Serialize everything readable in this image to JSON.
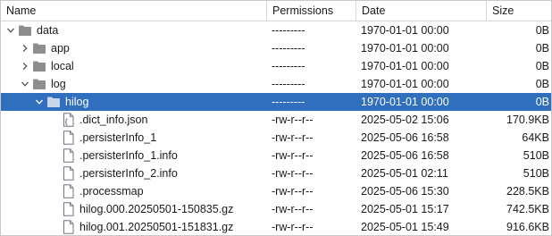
{
  "columns": {
    "name": "Name",
    "permissions": "Permissions",
    "date": "Date",
    "size": "Size"
  },
  "rows": [
    {
      "name": "data",
      "type": "folder",
      "expanded": true,
      "level": 0,
      "permissions": "---------",
      "date": "1970-01-01 00:00",
      "size": "0B"
    },
    {
      "name": "app",
      "type": "folder",
      "expanded": false,
      "level": 1,
      "permissions": "---------",
      "date": "1970-01-01 00:00",
      "size": "0B"
    },
    {
      "name": "local",
      "type": "folder",
      "expanded": false,
      "level": 1,
      "permissions": "---------",
      "date": "1970-01-01 00:00",
      "size": "0B"
    },
    {
      "name": "log",
      "type": "folder",
      "expanded": true,
      "level": 1,
      "permissions": "---------",
      "date": "1970-01-01 00:00",
      "size": "0B"
    },
    {
      "name": "hilog",
      "type": "folder",
      "expanded": true,
      "level": 2,
      "selected": true,
      "permissions": "---------",
      "date": "1970-01-01 00:00",
      "size": "0B"
    },
    {
      "name": ".dict_info.json",
      "type": "file-json",
      "level": 3,
      "permissions": "-rw-r--r--",
      "date": "2025-05-02 15:06",
      "size": "170.9KB"
    },
    {
      "name": ".persisterInfo_1",
      "type": "file",
      "level": 3,
      "permissions": "-rw-r--r--",
      "date": "2025-05-06 16:58",
      "size": "64KB"
    },
    {
      "name": ".persisterInfo_1.info",
      "type": "file",
      "level": 3,
      "permissions": "-rw-r--r--",
      "date": "2025-05-06 16:58",
      "size": "510B"
    },
    {
      "name": ".persisterInfo_2.info",
      "type": "file",
      "level": 3,
      "permissions": "-rw-r--r--",
      "date": "2025-05-01 02:11",
      "size": "510B"
    },
    {
      "name": ".processmap",
      "type": "file",
      "level": 3,
      "permissions": "-rw-r--r--",
      "date": "2025-05-06 15:30",
      "size": "228.5KB"
    },
    {
      "name": "hilog.000.20250501-150835.gz",
      "type": "file",
      "level": 3,
      "permissions": "-rw-r--r--",
      "date": "2025-05-01 15:17",
      "size": "742.5KB"
    },
    {
      "name": "hilog.001.20250501-151831.gz",
      "type": "file",
      "level": 3,
      "permissions": "-rw-r--r--",
      "date": "2025-05-01 15:49",
      "size": "916.6KB"
    }
  ],
  "colors": {
    "selection": "#2f6fbd",
    "folder": "#8e8e8e",
    "file_outline": "#6d7683"
  }
}
